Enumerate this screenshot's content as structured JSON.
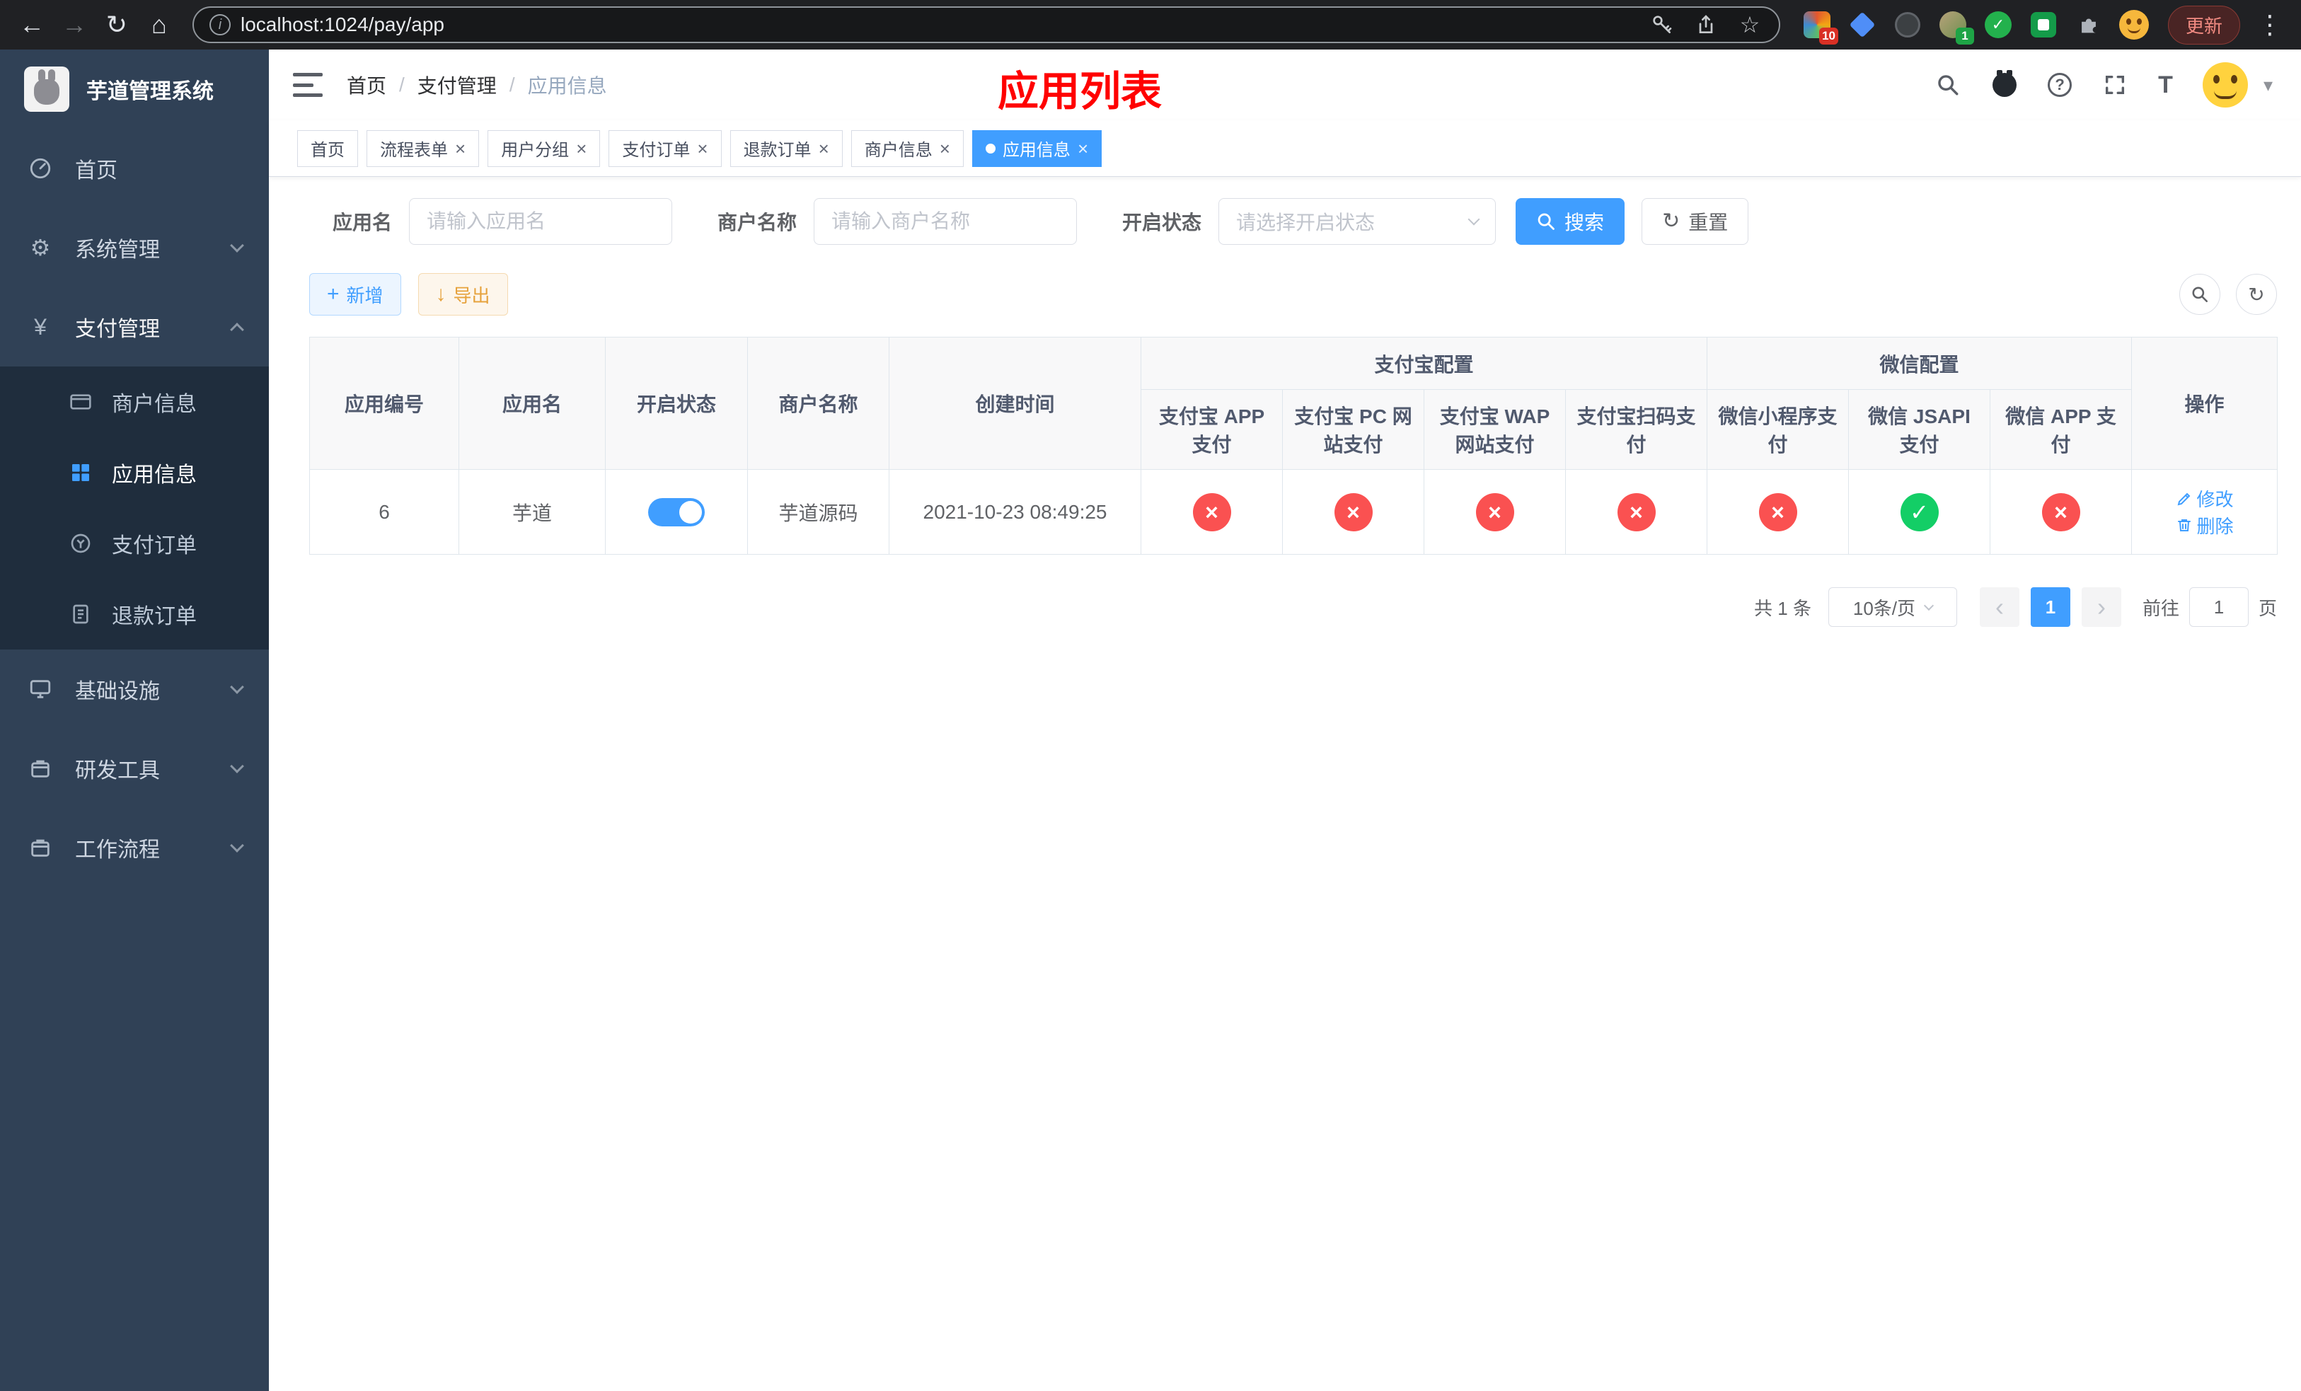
{
  "colors": {
    "accent": "#409EFF",
    "accent_light": "#ecf5ff",
    "accent_border": "#b3d8ff",
    "success": "#13ce66",
    "danger": "#fa5151",
    "warning": "#e6a23c",
    "warning_light": "#fdf6ec",
    "warning_border": "#f5dab1",
    "sidebar_bg": "#304156",
    "submenu_bg": "#1f2d3d",
    "annotation": "#ff0000"
  },
  "icons": {
    "back": "←",
    "forward": "→",
    "reload": "↻",
    "home": "⌂",
    "star": "☆",
    "dots": "⋮",
    "info": "i",
    "gear": "⚙",
    "yen": "¥",
    "close": "×",
    "check": "✓",
    "cross": "×",
    "plus": "+",
    "download": "↓",
    "refresh": "↻",
    "question": "?",
    "font_size": "T",
    "caret": "▾",
    "prev": "‹",
    "next": "›"
  },
  "browser": {
    "url": "localhost:1024/pay/app",
    "update_label": "更新",
    "extension_badges": {
      "first": "10",
      "second": "1"
    }
  },
  "sidebar": {
    "title": "芋道管理系统",
    "items": {
      "home": "首页",
      "system": "系统管理",
      "payment": "支付管理",
      "infra": "基础设施",
      "devtools": "研发工具",
      "workflow": "工作流程"
    },
    "payment_children": {
      "merchant": "商户信息",
      "app": "应用信息",
      "pay_order": "支付订单",
      "refund_order": "退款订单"
    }
  },
  "header": {
    "breadcrumb": {
      "home": "首页",
      "sep": "/",
      "level1": "支付管理",
      "level2": "应用信息"
    },
    "annotation": "应用列表"
  },
  "tabs": [
    {
      "label": "首页"
    },
    {
      "label": "流程表单"
    },
    {
      "label": "用户分组"
    },
    {
      "label": "支付订单"
    },
    {
      "label": "退款订单"
    },
    {
      "label": "商户信息"
    },
    {
      "label": "应用信息"
    }
  ],
  "filters": {
    "app_name_label": "应用名",
    "app_name_placeholder": "请输入应用名",
    "merchant_label": "商户名称",
    "merchant_placeholder": "请输入商户名称",
    "status_label": "开启状态",
    "status_placeholder": "请选择开启状态",
    "search_label": "搜索",
    "reset_label": "重置"
  },
  "toolbar": {
    "add_label": "新增",
    "export_label": "导出"
  },
  "table": {
    "group_headers": {
      "alipay": "支付宝配置",
      "wechat": "微信配置"
    },
    "columns": [
      "应用编号",
      "应用名",
      "开启状态",
      "商户名称",
      "创建时间",
      "支付宝 APP 支付",
      "支付宝 PC 网站支付",
      "支付宝 WAP 网站支付",
      "支付宝扫码支付",
      "微信小程序支付",
      "微信 JSAPI 支付",
      "微信 APP 支付",
      "操作"
    ],
    "rows": [
      {
        "id": "6",
        "name": "芋道",
        "enabled": true,
        "merchant": "芋道源码",
        "created": "2021-10-23 08:49:25",
        "channels": {
          "alipay_app": false,
          "alipay_pc": false,
          "alipay_wap": false,
          "alipay_qr": false,
          "wx_lite": false,
          "wx_jsapi": true,
          "wx_app": false
        },
        "edit_label": "修改",
        "delete_label": "删除"
      }
    ]
  },
  "pagination": {
    "total": "共 1 条",
    "page_size": "10条/页",
    "current_page": "1",
    "goto_label": "前往",
    "goto_value": "1",
    "page_unit": "页"
  }
}
